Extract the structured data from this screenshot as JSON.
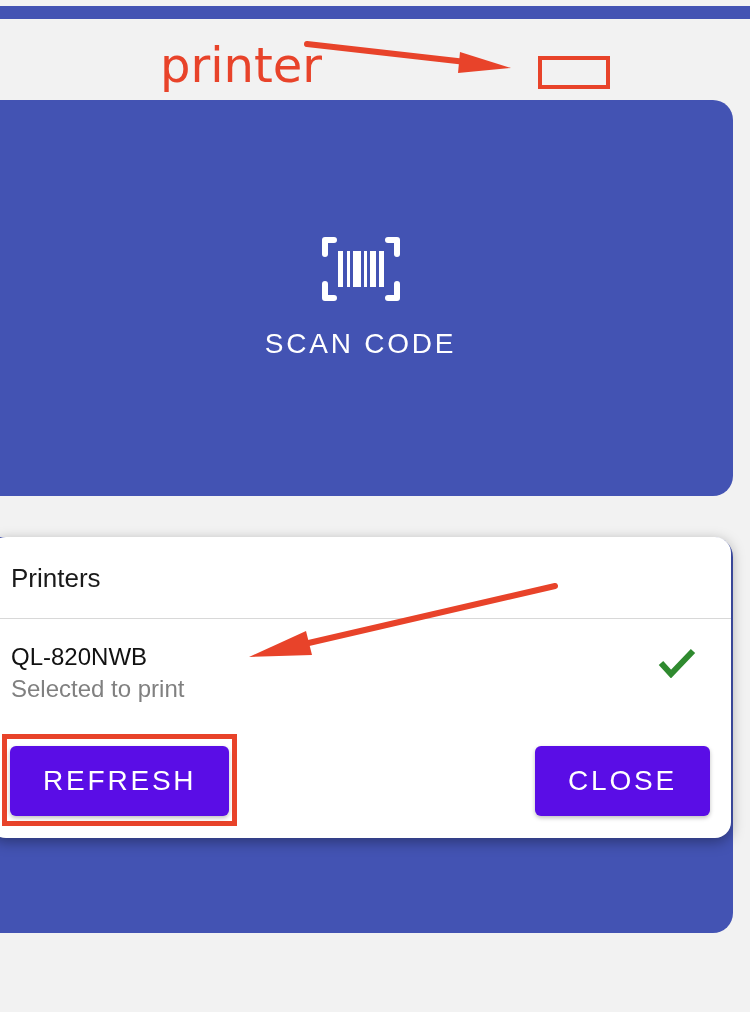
{
  "annotation": {
    "label": "printer"
  },
  "scan_tile": {
    "label": "SCAN CODE"
  },
  "printers_dialog": {
    "title": "Printers",
    "printers": [
      {
        "name": "QL-820NWB",
        "status": "Selected to print",
        "selected": true
      }
    ],
    "buttons": [
      {
        "label": "REFRESH",
        "highlighted": true
      },
      {
        "label": "CLOSE",
        "highlighted": false
      }
    ]
  }
}
